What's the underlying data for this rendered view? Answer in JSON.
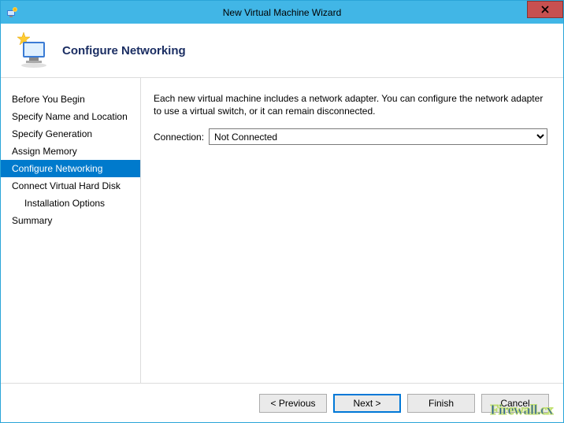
{
  "window": {
    "title": "New Virtual Machine Wizard"
  },
  "header": {
    "page_title": "Configure Networking"
  },
  "sidebar": {
    "steps": [
      {
        "label": "Before You Begin",
        "active": false,
        "indent": false
      },
      {
        "label": "Specify Name and Location",
        "active": false,
        "indent": false
      },
      {
        "label": "Specify Generation",
        "active": false,
        "indent": false
      },
      {
        "label": "Assign Memory",
        "active": false,
        "indent": false
      },
      {
        "label": "Configure Networking",
        "active": true,
        "indent": false
      },
      {
        "label": "Connect Virtual Hard Disk",
        "active": false,
        "indent": false
      },
      {
        "label": "Installation Options",
        "active": false,
        "indent": true
      },
      {
        "label": "Summary",
        "active": false,
        "indent": false
      }
    ]
  },
  "content": {
    "description": "Each new virtual machine includes a network adapter. You can configure the network adapter to use a virtual switch, or it can remain disconnected.",
    "connection_label": "Connection:",
    "connection_value": "Not Connected"
  },
  "footer": {
    "previous": "< Previous",
    "next": "Next >",
    "finish": "Finish",
    "cancel": "Cancel"
  },
  "watermark": "Firewall.cx"
}
